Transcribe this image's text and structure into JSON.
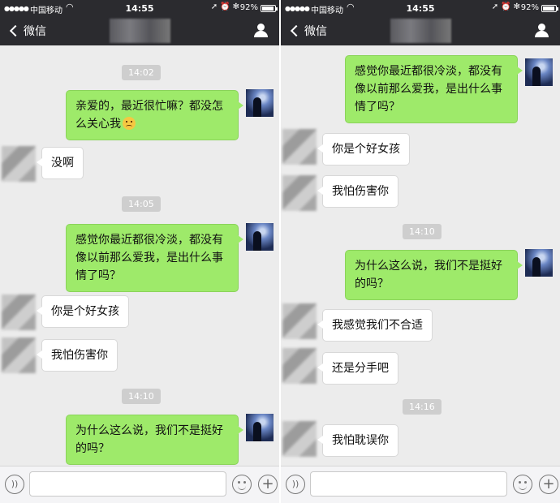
{
  "status_bar": {
    "signal": "●●●●●",
    "carrier": "中国移动",
    "wifi_icon": "wifi-icon",
    "time": "14:55",
    "icons": "➚⏰✻",
    "battery": "92%"
  },
  "nav": {
    "back_label": "微信",
    "contact_name_blurred": true
  },
  "left_panel": {
    "timestamps": [
      "14:02",
      "14:05",
      "14:10"
    ],
    "messages": [
      {
        "side": "me",
        "text": "亲爱的，最近很忙嘛？都没怎么关心我",
        "emoji": "sad-face-emoji"
      },
      {
        "side": "them",
        "text": "没啊"
      },
      {
        "side": "me",
        "text": "感觉你最近都很冷淡，都没有像以前那么爱我，是出什么事情了吗？"
      },
      {
        "side": "them",
        "text": "你是个好女孩"
      },
      {
        "side": "them",
        "text": "我怕伤害你"
      },
      {
        "side": "me",
        "text": "为什么这么说，我们不是挺好的吗？"
      }
    ]
  },
  "right_panel": {
    "timestamps": [
      "14:10",
      "14:16"
    ],
    "messages": [
      {
        "side": "me",
        "text": "感觉你最近都很冷淡，都没有像以前那么爱我，是出什么事情了吗？"
      },
      {
        "side": "them",
        "text": "你是个好女孩"
      },
      {
        "side": "them",
        "text": "我怕伤害你"
      },
      {
        "side": "me",
        "text": "为什么这么说，我们不是挺好的吗？"
      },
      {
        "side": "them",
        "text": "我感觉我们不合适"
      },
      {
        "side": "them",
        "text": "还是分手吧"
      },
      {
        "side": "them",
        "text": "我怕耽误你"
      }
    ]
  },
  "input_bar": {
    "voice_icon": "voice-icon",
    "emoji_icon": "emoji-icon",
    "plus_icon": "plus-icon",
    "plus_glyph": "+"
  },
  "colors": {
    "header": "#2b2b2f",
    "chat_bg": "#ececec",
    "my_bubble": "#9eea6a",
    "their_bubble": "#ffffff",
    "timestamp": "#cecece"
  }
}
